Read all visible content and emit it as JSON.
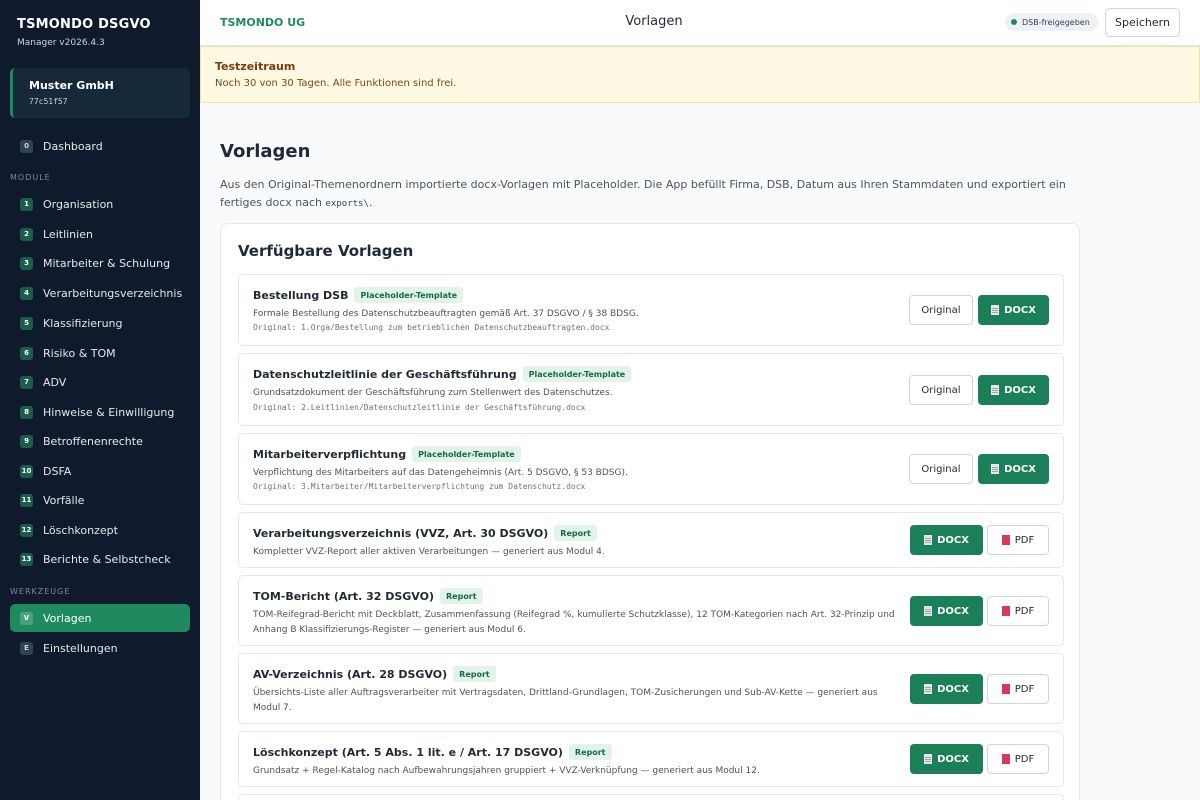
{
  "app": {
    "name": "TSMONDO DSGVO",
    "version": "Manager v2026.4.3"
  },
  "company": {
    "name": "Muster GmbH",
    "id": "77c51f57"
  },
  "sidebar": {
    "dashboard": {
      "badge": "0",
      "label": "Dashboard"
    },
    "module_label": "MODULE",
    "modules": [
      {
        "badge": "1",
        "label": "Organisation"
      },
      {
        "badge": "2",
        "label": "Leitlinien"
      },
      {
        "badge": "3",
        "label": "Mitarbeiter & Schulung"
      },
      {
        "badge": "4",
        "label": "Verarbeitungsverzeichnis"
      },
      {
        "badge": "5",
        "label": "Klassifizierung"
      },
      {
        "badge": "6",
        "label": "Risiko & TOM"
      },
      {
        "badge": "7",
        "label": "ADV"
      },
      {
        "badge": "8",
        "label": "Hinweise & Einwilligung"
      },
      {
        "badge": "9",
        "label": "Betroffenenrechte"
      },
      {
        "badge": "10",
        "label": "DSFA"
      },
      {
        "badge": "11",
        "label": "Vorfälle"
      },
      {
        "badge": "12",
        "label": "Löschkonzept"
      },
      {
        "badge": "13",
        "label": "Berichte & Selbstcheck"
      }
    ],
    "tools_label": "WERKZEUGE",
    "tools": [
      {
        "badge": "V",
        "label": "Vorlagen"
      },
      {
        "badge": "E",
        "label": "Einstellungen"
      }
    ]
  },
  "header": {
    "company": "TSMONDO UG",
    "title": "Vorlagen",
    "status": "DSB-freigegeben",
    "save_label": "Speichern"
  },
  "trial": {
    "title": "Testzeitraum",
    "text": "Noch 30 von 30 Tagen. Alle Funktionen sind frei."
  },
  "main": {
    "title": "Vorlagen",
    "desc_before": "Aus den Original-Themenordnern importierte docx-Vorlagen mit Placeholder. Die App befüllt Firma, DSB, Datum aus Ihren Stammdaten und exportiert ein fertiges docx nach ",
    "desc_code": "exports\\",
    "desc_after": ".",
    "card_title": "Verfügbare Vorlagen",
    "templates": [
      {
        "title": "Bestellung DSB",
        "tag": "Placeholder-Template",
        "desc": "Formale Bestellung des Datenschutzbeauftragten gemäß Art. 37 DSGVO / § 38 BDSG.",
        "original": "Original: 1.Orga/Bestellung zum betrieblichen Datenschutzbeauftragten.docx",
        "btn_original": "Original",
        "btn_docx": "DOCX"
      },
      {
        "title": "Datenschutzleitlinie der Geschäftsführung",
        "tag": "Placeholder-Template",
        "desc": "Grundsatzdokument der Geschäftsführung zum Stellenwert des Datenschutzes.",
        "original": "Original: 2.Leitlinien/Datenschutzleitlinie der Geschäftsführung.docx",
        "btn_original": "Original",
        "btn_docx": "DOCX"
      },
      {
        "title": "Mitarbeiterverpflichtung",
        "tag": "Placeholder-Template",
        "desc": "Verpflichtung des Mitarbeiters auf das Datengeheimnis (Art. 5 DSGVO, § 53 BDSG).",
        "original": "Original: 3.Mitarbeiter/Mitarbeiterverpflichtung zum Datenschutz.docx",
        "btn_original": "Original",
        "btn_docx": "DOCX"
      },
      {
        "title": "Verarbeitungsverzeichnis (VVZ, Art. 30 DSGVO)",
        "tag": "Report",
        "desc": "Kompletter VVZ-Report aller aktiven Verarbeitungen — generiert aus Modul 4.",
        "btn_docx": "DOCX",
        "btn_pdf": "PDF"
      },
      {
        "title": "TOM-Bericht (Art. 32 DSGVO)",
        "tag": "Report",
        "desc": "TOM-Reifegrad-Bericht mit Deckblatt, Zusammenfassung (Reifegrad %, kumulierte Schutzklasse), 12 TOM-Kategorien nach Art. 32-Prinzip und Anhang B Klassifizierungs-Register — generiert aus Modul 6.",
        "btn_docx": "DOCX",
        "btn_pdf": "PDF"
      },
      {
        "title": "AV-Verzeichnis (Art. 28 DSGVO)",
        "tag": "Report",
        "desc": "Übersichts-Liste aller Auftragsverarbeiter mit Vertragsdaten, Drittland-Grundlagen, TOM-Zusicherungen und Sub-AV-Kette — generiert aus Modul 7.",
        "btn_docx": "DOCX",
        "btn_pdf": "PDF"
      },
      {
        "title": "Löschkonzept (Art. 5 Abs. 1 lit. e / Art. 17 DSGVO)",
        "tag": "Report",
        "desc": "Grundsatz + Regel-Katalog nach Aufbewahrungsjahren gruppiert + VVZ-Verknüpfung — generiert aus Modul 12.",
        "btn_docx": "DOCX",
        "btn_pdf": "PDF"
      }
    ]
  }
}
